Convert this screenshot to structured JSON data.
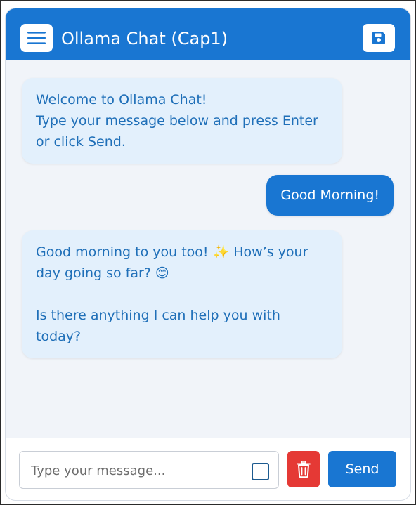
{
  "header": {
    "title": "Ollama Chat (Cap1)",
    "menu_icon": "hamburger-menu-icon",
    "save_icon": "floppy-disk-icon"
  },
  "messages": [
    {
      "role": "assistant",
      "text": "Welcome to Ollama Chat!\nType your message below and press Enter or click Send."
    },
    {
      "role": "user",
      "text": "Good Morning!"
    },
    {
      "role": "assistant",
      "text": "Good morning to you too! ✨  How’s your day going so far? 😊\n\nIs there anything I can help you with today?"
    }
  ],
  "composer": {
    "placeholder": "Type your message...",
    "value": "",
    "checkbox_checked": false,
    "trash_icon": "trash-icon",
    "send_label": "Send"
  },
  "colors": {
    "primary": "#1976d2",
    "danger": "#e53935",
    "assistant_bubble": "#e3f0fc",
    "assistant_text": "#1f6fb8"
  }
}
